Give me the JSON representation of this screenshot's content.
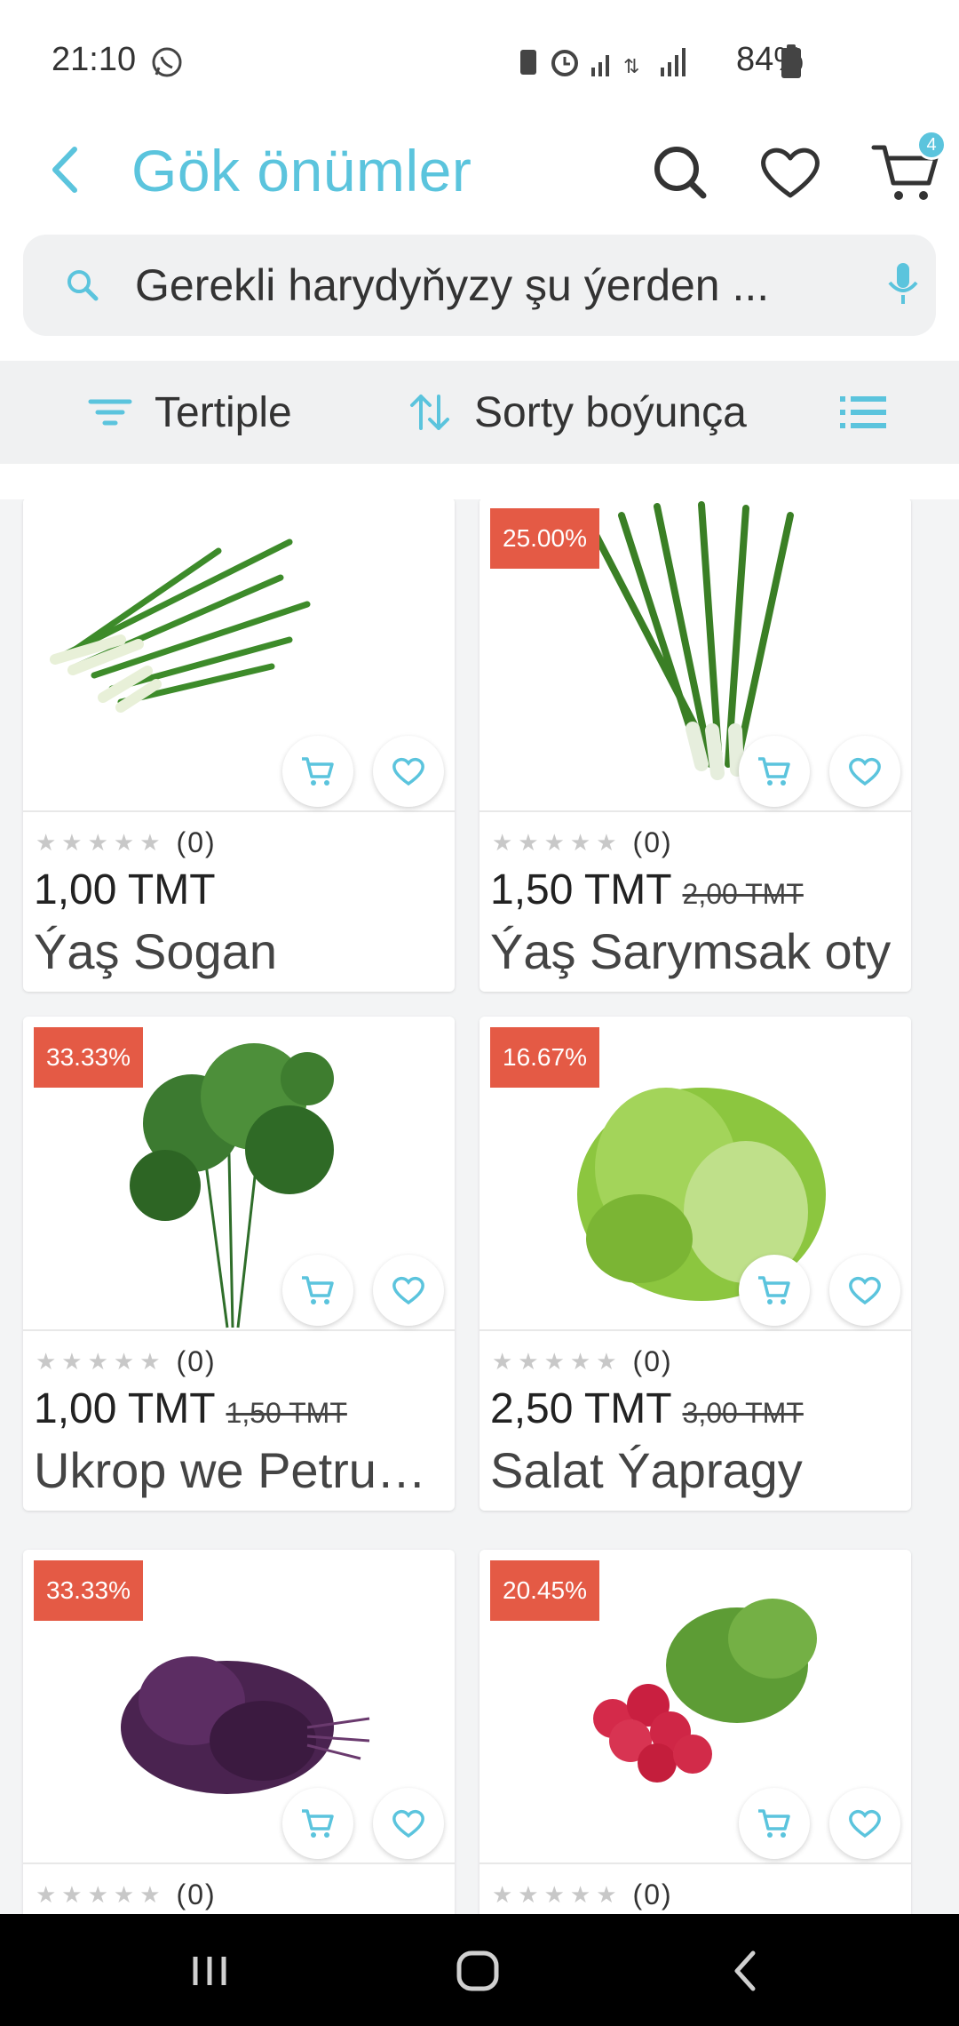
{
  "status": {
    "time": "21:10",
    "battery": "84%"
  },
  "header": {
    "title": "Gök önümler",
    "cart_count": "4"
  },
  "search": {
    "placeholder": "Gerekli harydyňyzy şu ýerden ..."
  },
  "filters": {
    "filter_label": "Tertiple",
    "sort_label": "Sorty boýunça"
  },
  "products": [
    {
      "name": "Ýaş Sogan",
      "price": "1,00 TMT",
      "old_price": "",
      "discount": "",
      "rating_count": "(0)"
    },
    {
      "name": "Ýaş Sarymsak oty",
      "price": "1,50 TMT",
      "old_price": "2,00 TMT",
      "discount": "25.00%",
      "rating_count": "(0)"
    },
    {
      "name": "Ukrop we Petruşka",
      "price": "1,00 TMT",
      "old_price": "1,50 TMT",
      "discount": "33.33%",
      "rating_count": "(0)"
    },
    {
      "name": "Salat Ýapragy",
      "price": "2,50 TMT",
      "old_price": "3,00 TMT",
      "discount": "16.67%",
      "rating_count": "(0)"
    },
    {
      "name": "",
      "price": "",
      "old_price": "",
      "discount": "33.33%",
      "rating_count": "(0)"
    },
    {
      "name": "",
      "price": "",
      "old_price": "",
      "discount": "20.45%",
      "rating_count": "(0)"
    }
  ],
  "colors": {
    "accent": "#5bc4dd",
    "discount": "#e45a45"
  }
}
